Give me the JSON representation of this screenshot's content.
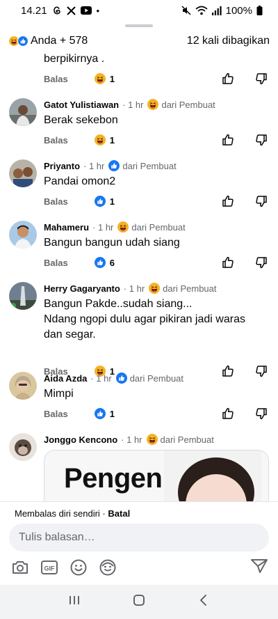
{
  "status": {
    "time": "14.21",
    "battery": "100%"
  },
  "header": {
    "reactions_text": "Anda + 578",
    "shares": "12 kali dibagikan"
  },
  "top_comment": {
    "text": "berpikirnya .",
    "reply": "Balas",
    "count": "1"
  },
  "comments": [
    {
      "name": "Gatot Yulistiawan",
      "time": "· 1 hr",
      "badge": "dari Pembuat",
      "text": "Berak sekebon",
      "reply": "Balas",
      "count": "1"
    },
    {
      "name": "Priyanto",
      "time": "· 1 hr",
      "badge": "dari Pembuat",
      "text": "Pandai omon2",
      "reply": "Balas",
      "count": "1"
    },
    {
      "name": "Mahameru",
      "time": "· 1 hr",
      "badge": "dari Pembuat",
      "text": "Bangun bangun udah siang",
      "reply": "Balas",
      "count": "6"
    },
    {
      "name": "Herry Gagaryanto",
      "time": "· 1 hr",
      "badge": "dari Pembuat",
      "text_lines": [
        "Bangun Pakde..sudah siang...",
        "Ndang ngopi dulu agar pikiran jadi waras",
        "dan segar."
      ],
      "reply": "Balas",
      "count": "1"
    },
    {
      "name": "Aida Azda",
      "time": "· 1 hr",
      "badge": "dari Pembuat",
      "text": "Mimpi",
      "reply": "Balas",
      "count": "1"
    },
    {
      "name": "Jonggo Kencono",
      "time": "· 1 hr",
      "badge": "dari Pembuat",
      "image_text": "Pengen"
    }
  ],
  "composer": {
    "replying_to": "Membalas diri sendiri ·",
    "cancel": "Batal",
    "placeholder": "Tulis balasan…"
  },
  "colors": {
    "accent": "#1877f2",
    "secondary_text": "#65676b",
    "haha": "#f7b125"
  },
  "icons": [
    "haha-emoji-icon",
    "like-icon",
    "thumbs-up-icon",
    "thumbs-down-icon",
    "camera-icon",
    "gif-icon",
    "emoji-icon",
    "avatar-sticker-icon",
    "send-icon"
  ]
}
